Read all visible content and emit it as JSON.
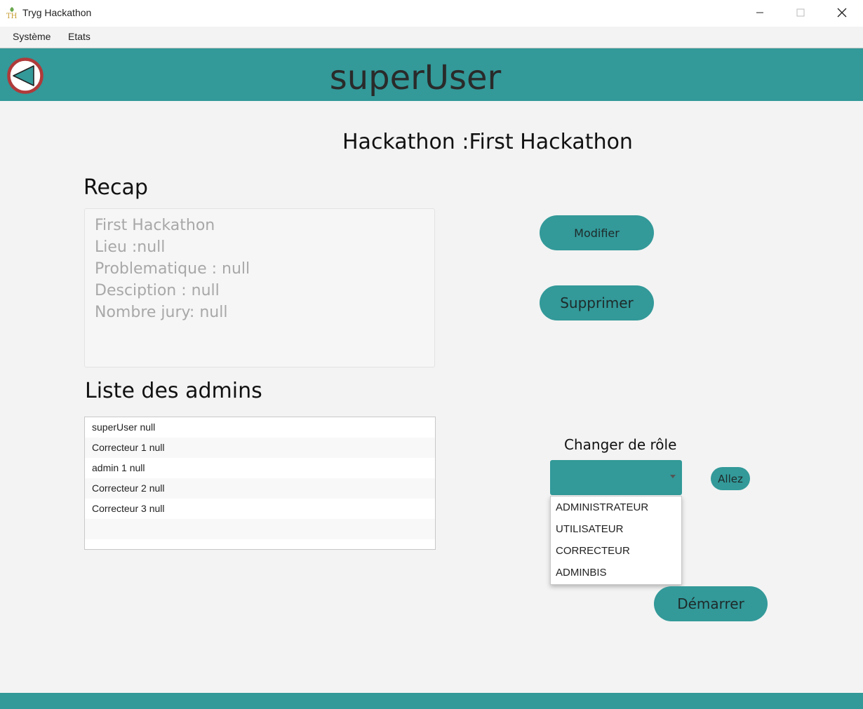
{
  "window": {
    "title": "Tryg Hackathon",
    "app_icon": "th-logo-icon",
    "controls": [
      "minimize-icon",
      "maximize-icon",
      "close-icon"
    ]
  },
  "menubar": {
    "items": [
      {
        "label": "Système"
      },
      {
        "label": "Etats"
      }
    ]
  },
  "header": {
    "title": "superUser",
    "back_icon": "back-arrow-icon"
  },
  "hackathon": {
    "label": "Hackathon :",
    "name": "First Hackathon"
  },
  "recap": {
    "title": "Recap",
    "lines": [
      "First Hackathon",
      "Lieu :null",
      "Problematique : null",
      "Desciption : null",
      "Nombre jury: null"
    ]
  },
  "actions": {
    "modify_label": "Modifier",
    "delete_label": "Supprimer",
    "start_label": "Démarrer"
  },
  "admins": {
    "title": "Liste des admins",
    "rows": [
      "superUser null",
      "Correcteur 1 null",
      "admin 1 null",
      "Correcteur 2 null",
      "Correcteur 3 null"
    ]
  },
  "role": {
    "label": "Changer de rôle",
    "selected": "",
    "go_label": "Allez",
    "options": [
      "ADMINISTRATEUR",
      "UTILISATEUR",
      "CORRECTEUR",
      "ADMINBIS"
    ]
  },
  "colors": {
    "accent": "#339999",
    "back_button_ring": "#b03a3a",
    "background": "#f3f3f3"
  }
}
